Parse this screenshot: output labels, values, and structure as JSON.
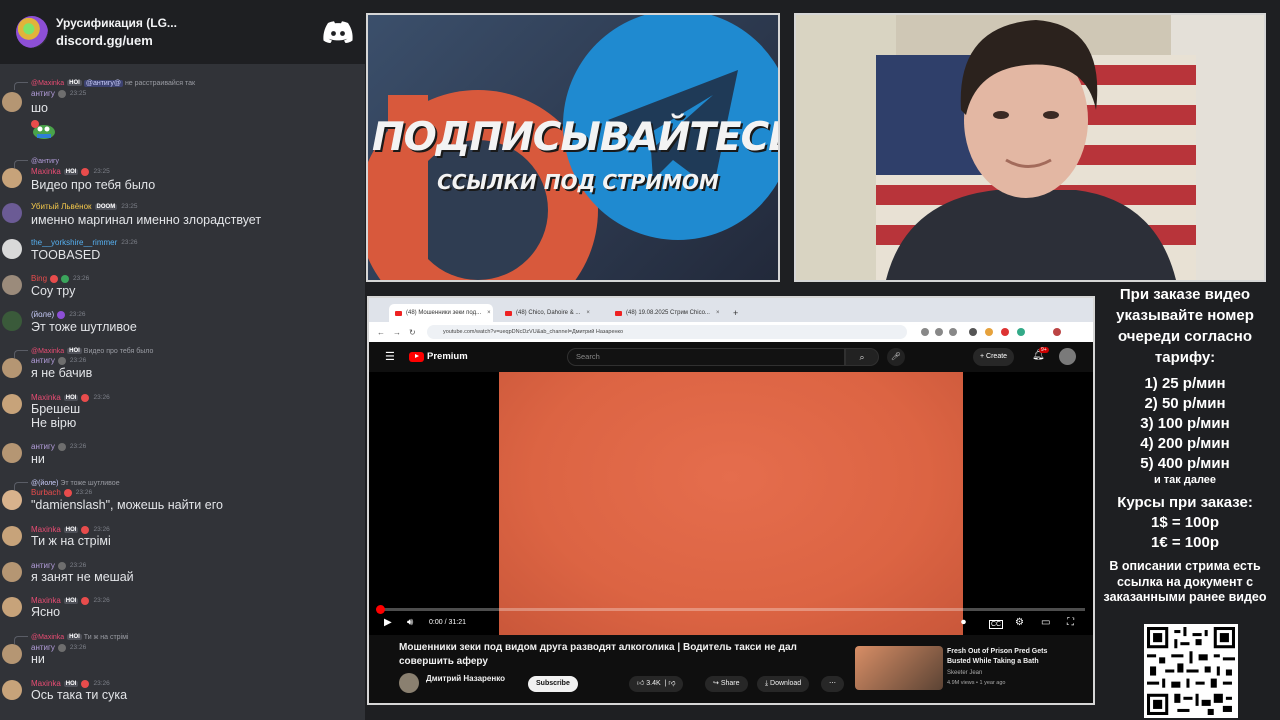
{
  "discord": {
    "server_name": "Урусификация (LG...",
    "server_url": "discord.gg/uem",
    "messages": [
      {
        "reply": "@Maxinka",
        "reply_tag": "HOI",
        "reply_mention": "@антигу@",
        "reply_text": "не расстраивайся так",
        "user": "антигу",
        "user_color": "#b39ddb",
        "time": "23:25",
        "text": "шо",
        "emote": true
      },
      {
        "reply": "@антигу",
        "reply_tag": "",
        "reply_mention": "",
        "reply_text": "",
        "user": "Maxinka",
        "user_color": "#e84c73",
        "tag": "HOI",
        "time": "23:25",
        "text": "Видео про тебя было"
      },
      {
        "user": "Убитый Львёнок",
        "user_color": "#f3c74b",
        "tag": "DOOM",
        "time": "23:25",
        "text": "именно маргинал именно злорадствует"
      },
      {
        "user": "the__yorkshire__rimmer",
        "user_color": "#56b0f0",
        "time": "23:26",
        "text": "TOOBASED"
      },
      {
        "user": "Bing",
        "user_color": "#e84c4c",
        "time": "23:26",
        "text": "Соу тру"
      },
      {
        "user": "(йоле)",
        "user_color": "#c9cdfb",
        "time": "23:26",
        "text": "Эт тоже шутливое"
      },
      {
        "reply": "@Maxinka",
        "reply_tag": "HOI",
        "reply_mention": "",
        "reply_text": "Видео про тебя было",
        "user": "антигу",
        "user_color": "#b39ddb",
        "time": "23:26",
        "text": "я не бачив"
      },
      {
        "user": "Maxinka",
        "user_color": "#e84c73",
        "tag": "HOI",
        "time": "23:26",
        "text": "Брешеш",
        "text2": "Не вірю"
      },
      {
        "user": "антигу",
        "user_color": "#b39ddb",
        "time": "23:26",
        "text": "ни"
      },
      {
        "reply": "@(йоле)",
        "reply_tag": "",
        "reply_mention": "",
        "reply_text": "Эт тоже шутливое",
        "user": "Burbach",
        "user_color": "#e84c4c",
        "time": "23:26",
        "text": "\"damienslash\", можешь найти его"
      },
      {
        "user": "Maxinka",
        "user_color": "#e84c73",
        "tag": "HOI",
        "time": "23:26",
        "text": "Ти ж на стрімі"
      },
      {
        "user": "антигу",
        "user_color": "#b39ddb",
        "time": "23:26",
        "text": "я занят не мешай"
      },
      {
        "user": "Maxinka",
        "user_color": "#e84c73",
        "tag": "HOI",
        "time": "23:26",
        "text": "Ясно"
      },
      {
        "reply": "@Maxinka",
        "reply_tag": "HOI",
        "reply_mention": "",
        "reply_text": "Ти ж на стрімі",
        "user": "антигу",
        "user_color": "#b39ddb",
        "time": "23:26",
        "text": "ни"
      },
      {
        "user": "Maxinka",
        "user_color": "#e84c73",
        "tag": "HOI",
        "time": "23:26",
        "text": "Ось така ти сука"
      }
    ]
  },
  "banner": {
    "title": "ПОДПИСЫВАЙТЕСЬ",
    "subtitle": "ССЫЛКИ ПОД СТРИМОМ"
  },
  "browser": {
    "tabs": [
      "(48) Мошенники зеки под...",
      "(48) Chico, Dahoire & ...",
      "(48) 19.08.2025 Стрим Chico..."
    ],
    "url": "youtube.com/watch?v=ueqpDNcDzVU&ab_channel=Дмитрий Назаренко",
    "yt_brand": "Premium",
    "search_placeholder": "Search",
    "create_label": "Create",
    "notif_count": "9+",
    "time_display": "0:00 / 31:21",
    "progress": 0.0,
    "video_title": "Мошенники зеки под видом друга разводят алкоголика | Водитель такси не дал совершить аферу",
    "channel_name": "Дмитрий Назаренко",
    "subscribe_label": "Subscribe",
    "likes": "3.4K",
    "share_label": "Share",
    "download_label": "Download",
    "rec_title": "Fresh Out of Prison Pred Gets Busted While Taking a Bath",
    "rec_channel": "Skeeter Jean",
    "rec_views": "4.9M views • 1 year ago"
  },
  "info": {
    "header": "При заказе видео указывайте номер очереди согласно тарифу:",
    "prices": [
      "1) 25 р/мин",
      "2) 50 р/мин",
      "3) 100 р/мин",
      "4) 200 р/мин",
      "5) 400 р/мин"
    ],
    "etc": "и так далее",
    "rates_header": "Курсы при заказе:",
    "rates": [
      "1$ = 100р",
      "1€ = 100р"
    ],
    "note": "В описании стрима есть ссылка на документ с заказанными ранее видео"
  }
}
